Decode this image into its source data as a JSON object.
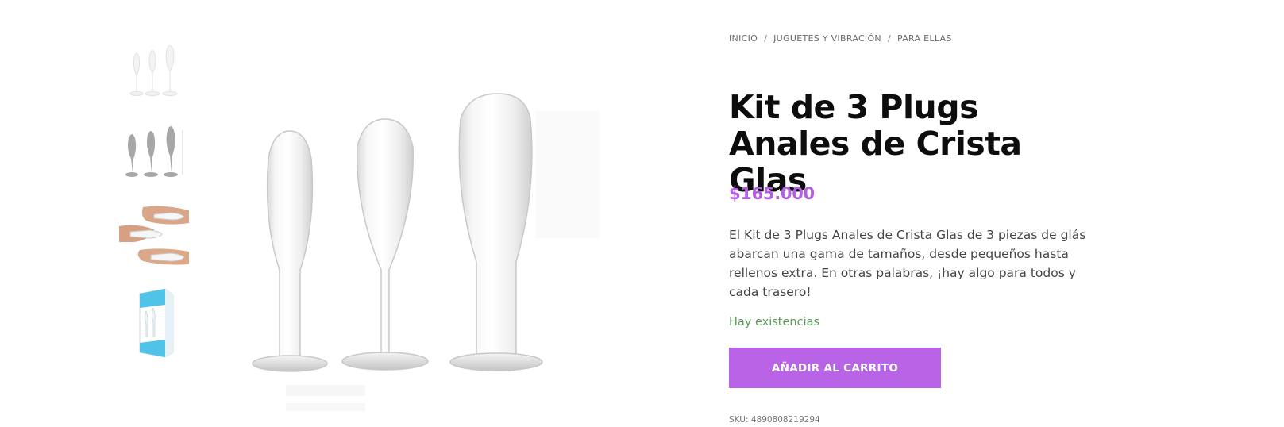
{
  "breadcrumb": {
    "items": [
      "INICIO",
      "JUGUETES Y VIBRACIÓN",
      "PARA ELLAS"
    ],
    "separator": "/"
  },
  "product": {
    "title": "Kit de 3 Plugs Anales de Crista Glas",
    "price": "$165.000",
    "description": "El Kit de 3 Plugs Anales de Crista Glas de 3 piezas de glás abarcan una gama de tamaños, desde pequeños hasta rellenos extra. En otras palabras, ¡hay algo para todos y cada trasero!",
    "stock": "Hay existencias",
    "add_to_cart_label": "AÑADIR AL CARRITO",
    "sku": "SKU: 4890808219294"
  },
  "gallery": {
    "thumbnails": [
      "clear-plugs-set",
      "plugs-with-dimensions",
      "plugs-in-hand",
      "product-box"
    ]
  },
  "colors": {
    "accent": "#b964e6",
    "price": "#b460e3",
    "stock": "#5e9a5a",
    "title": "#0d0d0d"
  }
}
